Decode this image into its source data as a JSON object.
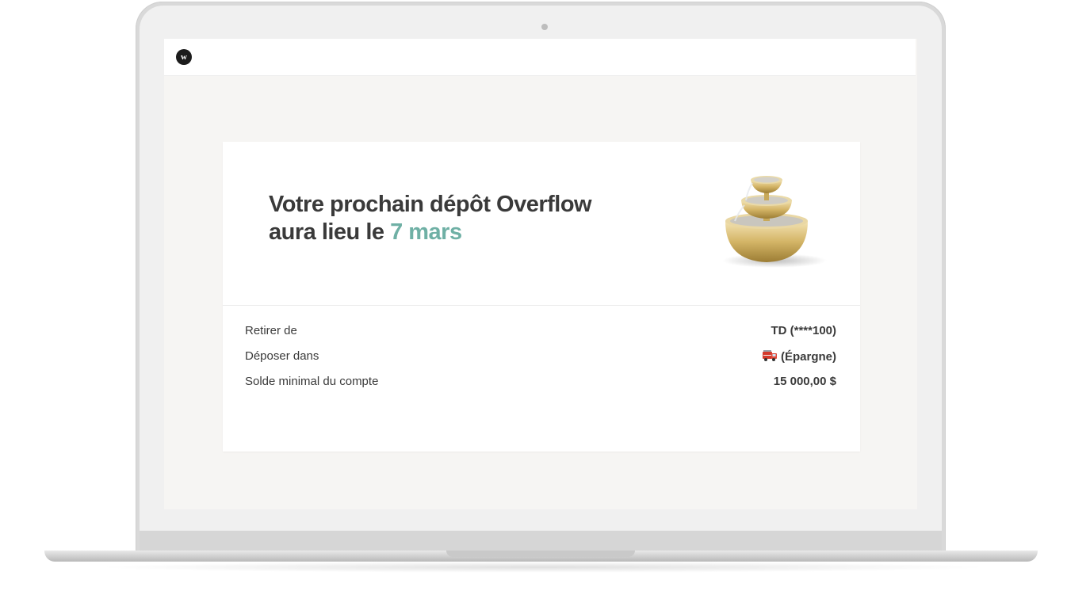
{
  "brand": {
    "logo_letter": "w"
  },
  "hero": {
    "headline_line1": "Votre prochain dépôt Overflow",
    "headline_line2_prefix": "aura lieu le ",
    "headline_date": "7 mars",
    "illustration": "gold-fountain-icon"
  },
  "details": {
    "withdraw_label": "Retirer de",
    "withdraw_value": "TD (****100)",
    "deposit_label": "Déposer dans",
    "deposit_value": "(Épargne)",
    "deposit_icon": "fire-truck-icon",
    "minimum_label": "Solde minimal du compte",
    "minimum_value": "15 000,00 $"
  },
  "colors": {
    "accent": "#6fb0a5",
    "text": "#3a3a3a",
    "background": "#f6f5f3"
  }
}
